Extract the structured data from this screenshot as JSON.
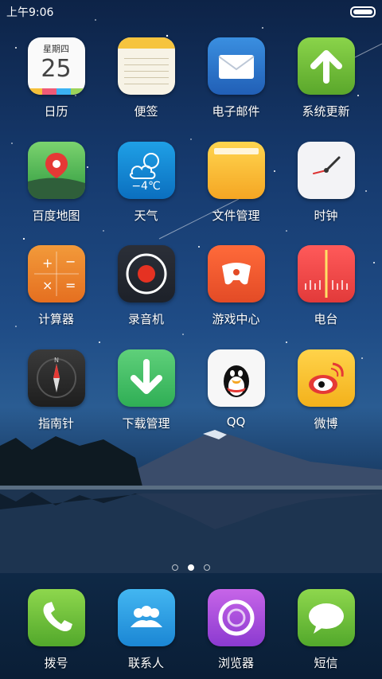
{
  "status": {
    "time": "上午9:06"
  },
  "calendar": {
    "weekday": "星期四",
    "day": "25"
  },
  "weather": {
    "temp": "−4℃"
  },
  "apps": {
    "calendar": "日历",
    "notes": "便签",
    "email": "电子邮件",
    "update": "系统更新",
    "maps": "百度地图",
    "weather": "天气",
    "files": "文件管理",
    "clock": "时钟",
    "calculator": "计算器",
    "recorder": "录音机",
    "games": "游戏中心",
    "radio": "电台",
    "compass": "指南针",
    "downloads": "下载管理",
    "qq": "QQ",
    "weibo": "微博"
  },
  "dock": {
    "phone": "拨号",
    "contacts": "联系人",
    "browser": "浏览器",
    "sms": "短信"
  },
  "pager": {
    "pages": 3,
    "active": 2
  },
  "icons": {
    "calendar": "calendar-icon",
    "notes": "notes-icon",
    "email": "envelope-icon",
    "update": "arrow-up-icon",
    "maps": "map-pin-icon",
    "weather": "cloud-sun-icon",
    "files": "folder-icon",
    "clock": "clock-icon",
    "calculator": "calculator-icon",
    "recorder": "record-icon",
    "games": "gamepad-icon",
    "radio": "radio-tuner-icon",
    "compass": "compass-icon",
    "downloads": "download-arrow-icon",
    "qq": "penguin-icon",
    "weibo": "weibo-eye-icon",
    "phone": "phone-handset-icon",
    "contacts": "people-icon",
    "browser": "browser-ring-icon",
    "sms": "speech-bubble-icon"
  }
}
